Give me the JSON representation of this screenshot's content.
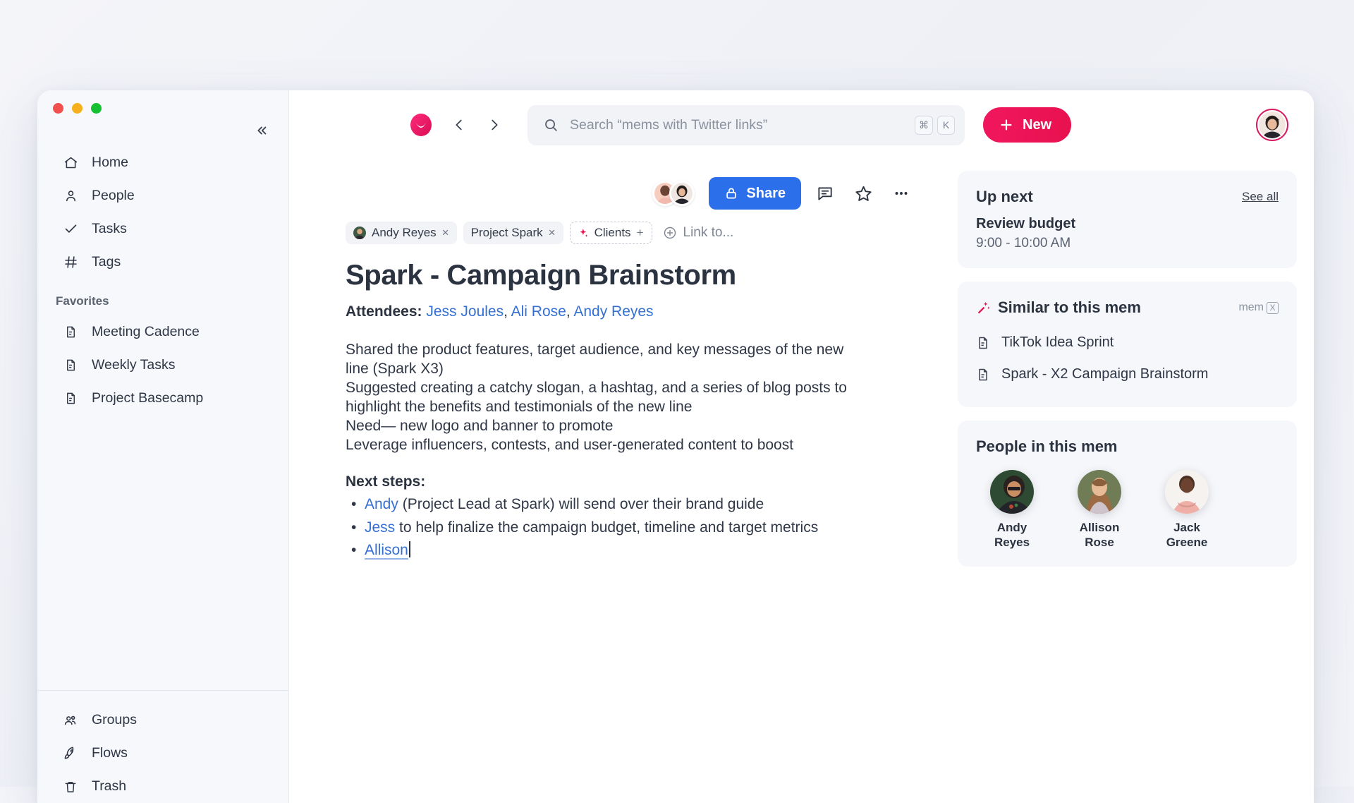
{
  "window": {
    "traffic_lights": [
      "close",
      "minimize",
      "maximize"
    ]
  },
  "sidebar": {
    "collapse_icon": "chevrons-left-icon",
    "items": [
      {
        "label": "Home",
        "icon": "home-icon"
      },
      {
        "label": "People",
        "icon": "person-icon"
      },
      {
        "label": "Tasks",
        "icon": "check-icon"
      },
      {
        "label": "Tags",
        "icon": "hash-icon"
      }
    ],
    "favorites_label": "Favorites",
    "favorites": [
      {
        "label": "Meeting Cadence",
        "icon": "document-icon"
      },
      {
        "label": "Weekly Tasks",
        "icon": "document-icon"
      },
      {
        "label": "Project Basecamp",
        "icon": "document-icon"
      }
    ],
    "bottom_items": [
      {
        "label": "Groups",
        "icon": "groups-icon"
      },
      {
        "label": "Flows",
        "icon": "rocket-icon"
      },
      {
        "label": "Trash",
        "icon": "trash-icon"
      }
    ]
  },
  "topbar": {
    "logo": "mem-logo-icon",
    "back_icon": "chevron-left-icon",
    "forward_icon": "chevron-right-icon",
    "search": {
      "icon": "search-icon",
      "placeholder": "Search “mems with Twitter links”",
      "value": "",
      "shortcut_keys": [
        "⌘",
        "K"
      ]
    },
    "new_button": {
      "label": "New",
      "icon": "plus-icon"
    },
    "avatar": "user-avatar"
  },
  "doc_toolbar": {
    "share_label": "Share",
    "share_icon": "lock-icon",
    "comment_icon": "comment-icon",
    "star_icon": "star-icon",
    "more_icon": "ellipsis-icon"
  },
  "document": {
    "chips": [
      {
        "label": "Andy Reyes",
        "type": "person",
        "remove": "×"
      },
      {
        "label": "Project Spark",
        "type": "tag",
        "remove": "×"
      },
      {
        "label": "Clients",
        "type": "suggested",
        "add": "+",
        "icon": "sparkle-icon"
      }
    ],
    "link_to": {
      "label": "Link to...",
      "icon": "plus-circle-icon"
    },
    "title": "Spark - Campaign Brainstorm",
    "attendees_label": "Attendees:",
    "attendees": [
      "Jess Joules",
      "Ali Rose",
      "Andy Reyes"
    ],
    "body_lines": [
      "Shared the product features, target audience, and key messages of the new line (Spark X3)",
      "Suggested creating a catchy slogan, a hashtag, and a series of blog posts to highlight the benefits and testimonials of the new line",
      "Need— new logo and banner to promote",
      "Leverage influencers, contests, and user-generated content to boost"
    ],
    "next_steps_heading": "Next steps:",
    "next_steps": [
      {
        "person": "Andy",
        "rest": " (Project Lead at Spark) will send over their brand guide"
      },
      {
        "person": "Jess",
        "rest": " to help finalize the campaign budget, timeline and target metrics"
      },
      {
        "person": "Allison",
        "rest": "",
        "active": true
      }
    ]
  },
  "rail": {
    "up_next": {
      "title": "Up next",
      "see_all": "See all",
      "event_title": "Review budget",
      "event_time": "9:00 - 10:00 AM"
    },
    "similar": {
      "title": "Similar to this mem",
      "icon": "sparkle-wand-icon",
      "badge_text": "mem",
      "badge_box": "X",
      "items": [
        {
          "label": "TikTok Idea Sprint",
          "icon": "document-icon"
        },
        {
          "label": "Spark - X2 Campaign Brainstorm",
          "icon": "document-icon"
        }
      ]
    },
    "people": {
      "title": "People in this mem",
      "members": [
        {
          "first": "Andy",
          "last": "Reyes"
        },
        {
          "first": "Allison",
          "last": "Rose"
        },
        {
          "first": "Jack",
          "last": "Greene"
        }
      ]
    }
  },
  "colors": {
    "accent_pink": "#f1175f",
    "share_blue": "#2c6fea",
    "link_blue": "#3470d4",
    "text_dark": "#2b3240",
    "sidebar_bg": "#f7f8fb",
    "card_bg": "#f6f7fa"
  }
}
